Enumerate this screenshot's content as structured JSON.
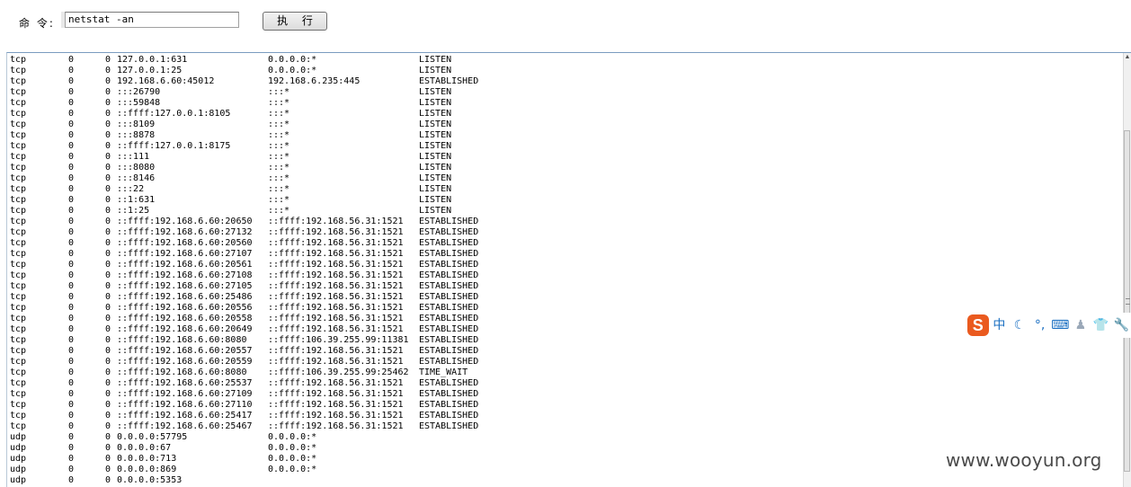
{
  "command": {
    "label": "命 令:",
    "value": "netstat -an"
  },
  "execute_button": "执 行",
  "output_rows": [
    [
      "tcp",
      "0",
      "0",
      "127.0.0.1:631",
      "0.0.0.0:*",
      "LISTEN"
    ],
    [
      "tcp",
      "0",
      "0",
      "127.0.0.1:25",
      "0.0.0.0:*",
      "LISTEN"
    ],
    [
      "tcp",
      "0",
      "0",
      "192.168.6.60:45012",
      "192.168.6.235:445",
      "ESTABLISHED"
    ],
    [
      "tcp",
      "0",
      "0",
      ":::26790",
      ":::*",
      "LISTEN"
    ],
    [
      "tcp",
      "0",
      "0",
      ":::59848",
      ":::*",
      "LISTEN"
    ],
    [
      "tcp",
      "0",
      "0",
      "::ffff:127.0.0.1:8105",
      ":::*",
      "LISTEN"
    ],
    [
      "tcp",
      "0",
      "0",
      ":::8109",
      ":::*",
      "LISTEN"
    ],
    [
      "tcp",
      "0",
      "0",
      ":::8878",
      ":::*",
      "LISTEN"
    ],
    [
      "tcp",
      "0",
      "0",
      "::ffff:127.0.0.1:8175",
      ":::*",
      "LISTEN"
    ],
    [
      "tcp",
      "0",
      "0",
      ":::111",
      ":::*",
      "LISTEN"
    ],
    [
      "tcp",
      "0",
      "0",
      ":::8080",
      ":::*",
      "LISTEN"
    ],
    [
      "tcp",
      "0",
      "0",
      ":::8146",
      ":::*",
      "LISTEN"
    ],
    [
      "tcp",
      "0",
      "0",
      ":::22",
      ":::*",
      "LISTEN"
    ],
    [
      "tcp",
      "0",
      "0",
      "::1:631",
      ":::*",
      "LISTEN"
    ],
    [
      "tcp",
      "0",
      "0",
      "::1:25",
      ":::*",
      "LISTEN"
    ],
    [
      "tcp",
      "0",
      "0",
      "::ffff:192.168.6.60:20650",
      "::ffff:192.168.56.31:1521",
      "ESTABLISHED"
    ],
    [
      "tcp",
      "0",
      "0",
      "::ffff:192.168.6.60:27132",
      "::ffff:192.168.56.31:1521",
      "ESTABLISHED"
    ],
    [
      "tcp",
      "0",
      "0",
      "::ffff:192.168.6.60:20560",
      "::ffff:192.168.56.31:1521",
      "ESTABLISHED"
    ],
    [
      "tcp",
      "0",
      "0",
      "::ffff:192.168.6.60:27107",
      "::ffff:192.168.56.31:1521",
      "ESTABLISHED"
    ],
    [
      "tcp",
      "0",
      "0",
      "::ffff:192.168.6.60:20561",
      "::ffff:192.168.56.31:1521",
      "ESTABLISHED"
    ],
    [
      "tcp",
      "0",
      "0",
      "::ffff:192.168.6.60:27108",
      "::ffff:192.168.56.31:1521",
      "ESTABLISHED"
    ],
    [
      "tcp",
      "0",
      "0",
      "::ffff:192.168.6.60:27105",
      "::ffff:192.168.56.31:1521",
      "ESTABLISHED"
    ],
    [
      "tcp",
      "0",
      "0",
      "::ffff:192.168.6.60:25486",
      "::ffff:192.168.56.31:1521",
      "ESTABLISHED"
    ],
    [
      "tcp",
      "0",
      "0",
      "::ffff:192.168.6.60:20556",
      "::ffff:192.168.56.31:1521",
      "ESTABLISHED"
    ],
    [
      "tcp",
      "0",
      "0",
      "::ffff:192.168.6.60:20558",
      "::ffff:192.168.56.31:1521",
      "ESTABLISHED"
    ],
    [
      "tcp",
      "0",
      "0",
      "::ffff:192.168.6.60:20649",
      "::ffff:192.168.56.31:1521",
      "ESTABLISHED"
    ],
    [
      "tcp",
      "0",
      "0",
      "::ffff:192.168.6.60:8080",
      "::ffff:106.39.255.99:11381",
      "ESTABLISHED"
    ],
    [
      "tcp",
      "0",
      "0",
      "::ffff:192.168.6.60:20557",
      "::ffff:192.168.56.31:1521",
      "ESTABLISHED"
    ],
    [
      "tcp",
      "0",
      "0",
      "::ffff:192.168.6.60:20559",
      "::ffff:192.168.56.31:1521",
      "ESTABLISHED"
    ],
    [
      "tcp",
      "0",
      "0",
      "::ffff:192.168.6.60:8080",
      "::ffff:106.39.255.99:25462",
      "TIME_WAIT"
    ],
    [
      "tcp",
      "0",
      "0",
      "::ffff:192.168.6.60:25537",
      "::ffff:192.168.56.31:1521",
      "ESTABLISHED"
    ],
    [
      "tcp",
      "0",
      "0",
      "::ffff:192.168.6.60:27109",
      "::ffff:192.168.56.31:1521",
      "ESTABLISHED"
    ],
    [
      "tcp",
      "0",
      "0",
      "::ffff:192.168.6.60:27110",
      "::ffff:192.168.56.31:1521",
      "ESTABLISHED"
    ],
    [
      "tcp",
      "0",
      "0",
      "::ffff:192.168.6.60:25417",
      "::ffff:192.168.56.31:1521",
      "ESTABLISHED"
    ],
    [
      "tcp",
      "0",
      "0",
      "::ffff:192.168.6.60:25467",
      "::ffff:192.168.56.31:1521",
      "ESTABLISHED"
    ],
    [
      "udp",
      "0",
      "0",
      "0.0.0.0:57795",
      "0.0.0.0:*",
      ""
    ],
    [
      "udp",
      "0",
      "0",
      "0.0.0.0:67",
      "0.0.0.0:*",
      ""
    ],
    [
      "udp",
      "0",
      "0",
      "0.0.0.0:713",
      "0.0.0.0:*",
      ""
    ],
    [
      "udp",
      "0",
      "0",
      "0.0.0.0:869",
      "0.0.0.0:*",
      ""
    ],
    [
      "udp",
      "0",
      "0",
      "0.0.0.0:5353",
      "",
      ""
    ]
  ],
  "ime_toolbar": {
    "logo": "S",
    "mode": "中",
    "icons": [
      "moon-icon",
      "punctuation-icon",
      "keyboard-icon",
      "person-icon",
      "shirt-icon",
      "wrench-icon"
    ]
  },
  "watermark": "www.wooyun.org"
}
